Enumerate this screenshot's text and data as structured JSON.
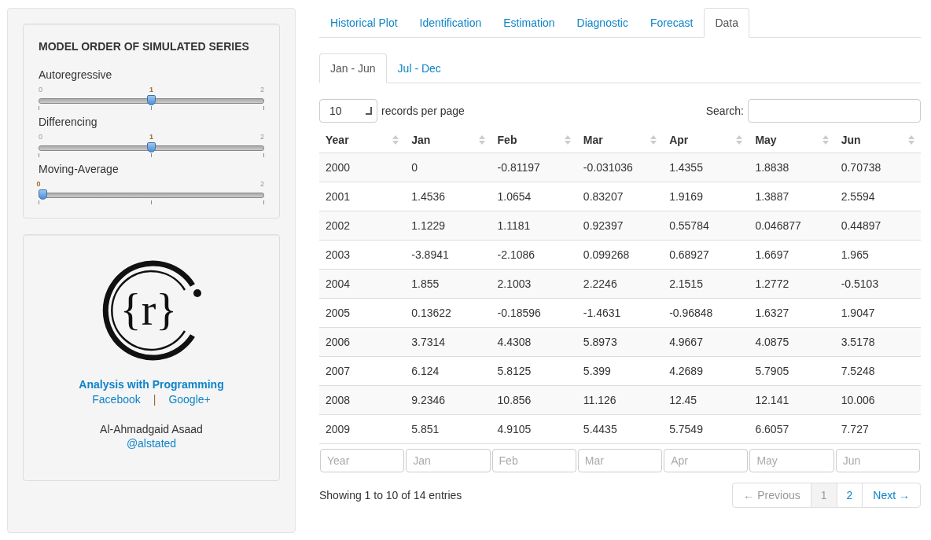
{
  "sidebar": {
    "title": "MODEL ORDER OF SIMULATED SERIES",
    "sliders": [
      {
        "label": "Autoregressive",
        "min_label": "0",
        "value_label": "1",
        "max_label": "2",
        "level": 0.5
      },
      {
        "label": "Differencing",
        "min_label": "0",
        "value_label": "1",
        "max_label": "2",
        "level": 0.5
      },
      {
        "label": "Moving-Average",
        "value_label": "0",
        "max_label": "2",
        "level": 0
      }
    ]
  },
  "about": {
    "logo_text": "{r}",
    "site": "Analysis with Programming",
    "links": [
      "Facebook",
      "Google+"
    ],
    "separator": "|",
    "author": "Al-Ahmadgaid Asaad",
    "handle": "@alstated"
  },
  "tabs": [
    {
      "label": "Historical Plot",
      "selected": false
    },
    {
      "label": "Identification",
      "selected": false
    },
    {
      "label": "Estimation",
      "selected": false
    },
    {
      "label": "Diagnostic",
      "selected": false
    },
    {
      "label": "Forecast",
      "selected": false
    },
    {
      "label": "Data",
      "selected": true
    }
  ],
  "subtabs": [
    {
      "label": "Jan - Jun",
      "selected": true
    },
    {
      "label": "Jul - Dec",
      "selected": false
    }
  ],
  "length": {
    "value": "10",
    "label": "records per page"
  },
  "search": {
    "label": "Search:"
  },
  "table": {
    "columns": [
      "Year",
      "Jan",
      "Feb",
      "Mar",
      "Apr",
      "May",
      "Jun"
    ],
    "rows": [
      [
        "2000",
        "0",
        "-0.81197",
        "-0.031036",
        "1.4355",
        "1.8838",
        "0.70738"
      ],
      [
        "2001",
        "1.4536",
        "1.0654",
        "0.83207",
        "1.9169",
        "1.3887",
        "2.5594"
      ],
      [
        "2002",
        "1.1229",
        "1.1181",
        "0.92397",
        "0.55784",
        "0.046877",
        "0.44897"
      ],
      [
        "2003",
        "-3.8941",
        "-2.1086",
        "0.099268",
        "0.68927",
        "1.6697",
        "1.965"
      ],
      [
        "2004",
        "1.855",
        "2.1003",
        "2.2246",
        "2.1515",
        "1.2772",
        "-0.5103"
      ],
      [
        "2005",
        "0.13622",
        "-0.18596",
        "-1.4631",
        "-0.96848",
        "1.6327",
        "1.9047"
      ],
      [
        "2006",
        "3.7314",
        "4.4308",
        "5.8973",
        "4.9667",
        "4.0875",
        "3.5178"
      ],
      [
        "2007",
        "6.124",
        "5.8125",
        "5.399",
        "4.2689",
        "5.7905",
        "7.5248"
      ],
      [
        "2008",
        "9.2346",
        "10.856",
        "11.126",
        "12.45",
        "12.141",
        "10.006"
      ],
      [
        "2009",
        "5.851",
        "4.9105",
        "5.4435",
        "5.7549",
        "6.6057",
        "7.727"
      ]
    ],
    "filter_placeholders": [
      "Year",
      "Jan",
      "Feb",
      "Mar",
      "Apr",
      "May",
      "Jun"
    ]
  },
  "info": "Showing 1 to 10 of 14 entries",
  "pagination": [
    {
      "label": "← Previous",
      "kind": "prev",
      "disabled": true,
      "selected": false
    },
    {
      "label": "1",
      "kind": "page",
      "disabled": false,
      "selected": true
    },
    {
      "label": "2",
      "kind": "page",
      "disabled": false,
      "selected": false
    },
    {
      "label": "Next →",
      "kind": "next",
      "disabled": false,
      "selected": false
    }
  ]
}
